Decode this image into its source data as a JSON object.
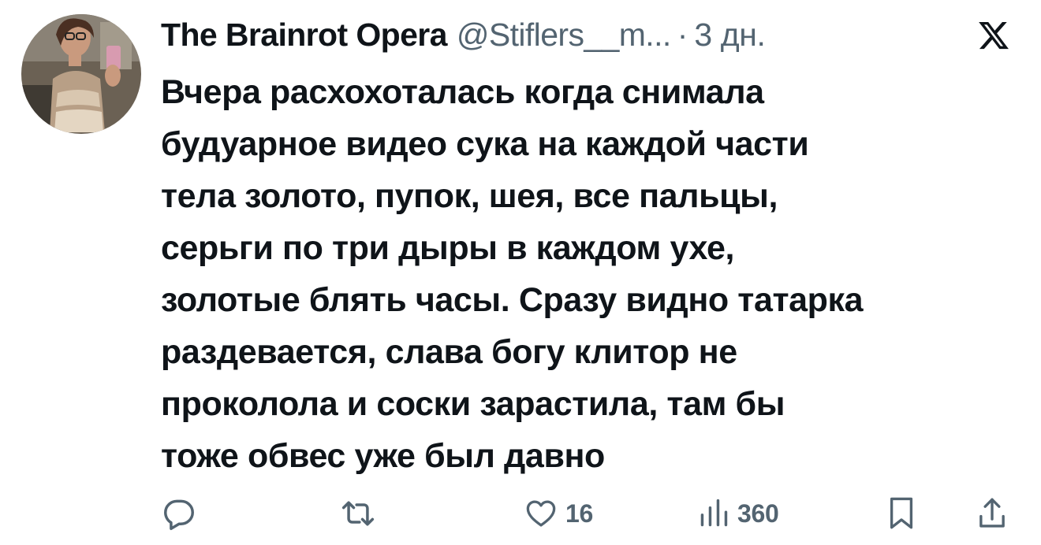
{
  "tweet": {
    "author_name": "The Brainrot Opera",
    "handle": "@Stiflers__m...",
    "separator": "·",
    "time": "3 дн.",
    "text_lines": [
      "Вчера расхохоталась когда снимала",
      "будуарное видео сука на каждой части",
      "тела золото, пупок, шея, все пальцы,",
      "серьги по три дыры в каждом ухе,",
      "золотые блять часы. Сразу видно татарка",
      "раздевается, слава богу клитор не",
      "проколола и соски зарастила, там бы",
      "тоже обвес уже был давно"
    ]
  },
  "actions": {
    "reply": {
      "icon": "reply-icon"
    },
    "retweet": {
      "icon": "retweet-icon"
    },
    "like": {
      "icon": "heart-icon",
      "count": "16"
    },
    "views": {
      "icon": "views-chart-icon",
      "count": "360"
    },
    "bookmark": {
      "icon": "bookmark-icon"
    },
    "share": {
      "icon": "share-icon"
    }
  },
  "brand": {
    "icon": "x-logo-icon"
  },
  "colors": {
    "text_primary": "#0f1419",
    "text_secondary": "#536471",
    "background": "#ffffff"
  }
}
